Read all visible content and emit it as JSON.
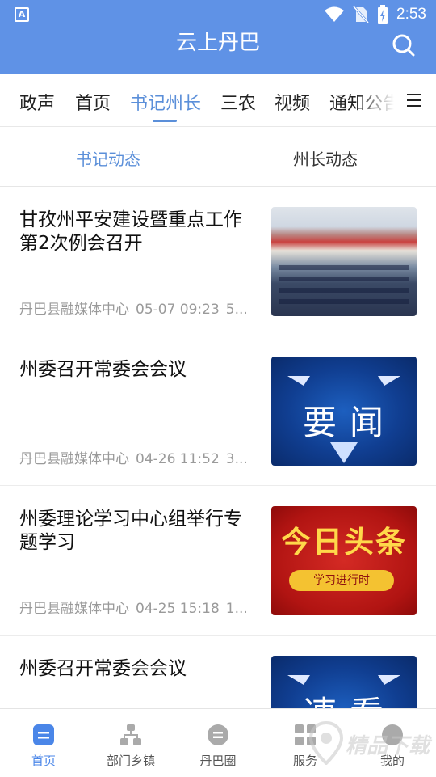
{
  "status_bar": {
    "left_icon": "A",
    "time": "2:53"
  },
  "header": {
    "title": "云上丹巴",
    "search_icon": "search-icon"
  },
  "channels": [
    "政声",
    "首页",
    "书记州长",
    "三农",
    "视频",
    "通知公告"
  ],
  "active_channel": "书记州长",
  "sub_tabs": [
    "书记动态",
    "州长动态"
  ],
  "news": [
    {
      "title": "甘孜州平安建设暨重点工作第2次例会召开",
      "source": "丹巴县融媒体中心",
      "time": "05-07 09:23",
      "extra": "5..."
    },
    {
      "title": "州委召开常委会会议",
      "source": "丹巴县融媒体中心",
      "time": "04-26 11:52",
      "extra": "3...",
      "thumb_text": "要闻"
    },
    {
      "title": "州委理论学习中心组举行专题学习",
      "source": "丹巴县融媒体中心",
      "time": "04-25 15:18",
      "extra": "1...",
      "thumb_text": "今日头条",
      "thumb_pill": "学习进行时"
    },
    {
      "title": "州委召开常委会会议",
      "thumb_text": "速看"
    }
  ],
  "bottom_nav": [
    {
      "label": "首页",
      "icon": "home-doc-icon"
    },
    {
      "label": "部门乡镇",
      "icon": "org-chart-icon"
    },
    {
      "label": "丹巴圈",
      "icon": "chat-bubble-icon"
    },
    {
      "label": "服务",
      "icon": "grid-icon"
    },
    {
      "label": "我的",
      "icon": "profile-icon"
    }
  ],
  "watermark": "精品下载",
  "colors": {
    "primary": "#5f92e6",
    "active_tab": "#5b8fd9",
    "meta_text": "#9a9a9a"
  }
}
